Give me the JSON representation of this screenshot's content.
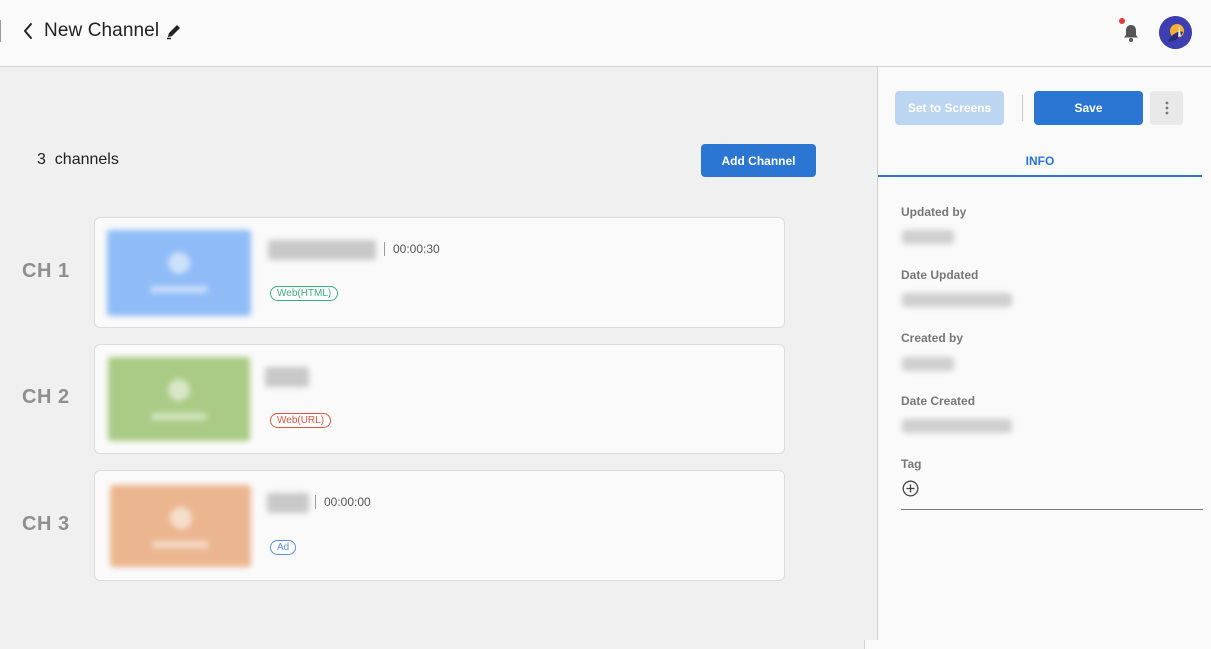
{
  "header": {
    "title": "New Channel"
  },
  "icons": {
    "back": "chevron-left-icon",
    "edit": "pencil-icon",
    "notifications": "bell-icon",
    "avatar": "user-avatar",
    "more": "more-vertical-icon",
    "add_tag": "plus-circle-icon"
  },
  "colors": {
    "primary": "#2a76d2",
    "primary_disabled": "#bcd5f1",
    "notification_dot": "#e53935",
    "badge_html": "#3cae7a",
    "badge_url": "#e0533d",
    "badge_ad": "#5b8de0",
    "thumb_ch1": "#8fbcf7",
    "thumb_ch2": "#aacb85",
    "thumb_ch3": "#ebb68f"
  },
  "main": {
    "channel_count": "3  channels",
    "add_channel_label": "Add Channel",
    "channels": [
      {
        "label": "CH 1",
        "duration": "00:00:30",
        "type": "Web(HTML)"
      },
      {
        "label": "CH 2",
        "duration": "",
        "type": "Web(URL)"
      },
      {
        "label": "CH 3",
        "duration": "00:00:00",
        "type": "Ad"
      }
    ]
  },
  "panel": {
    "set_to_screens_label": "Set to Screens",
    "save_label": "Save",
    "tab_info": "INFO",
    "fields": {
      "updated_by": "Updated by",
      "date_updated": "Date Updated",
      "created_by": "Created by",
      "date_created": "Date Created",
      "tag": "Tag"
    }
  }
}
